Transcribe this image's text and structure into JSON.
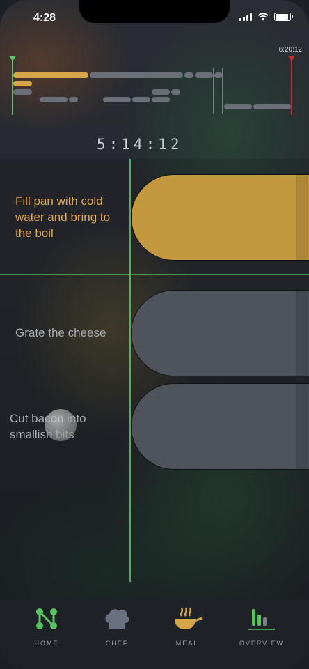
{
  "status_bar": {
    "time": "4:28"
  },
  "timeline": {
    "end_time": "6:20:12",
    "elapsed": "5:14:12"
  },
  "steps": [
    {
      "text": "Fill pan with cold water and bring to the boil",
      "state": "active"
    },
    {
      "text": "Grate the cheese",
      "state": "upcoming"
    },
    {
      "text": "Cut bacon into smallish bits",
      "state": "upcoming"
    }
  ],
  "tabs": [
    {
      "label": "HOME",
      "icon": "home-network-icon"
    },
    {
      "label": "CHEF",
      "icon": "chef-hat-icon"
    },
    {
      "label": "MEAL",
      "icon": "cooking-pan-icon"
    },
    {
      "label": "OVERVIEW",
      "icon": "bar-chart-icon"
    }
  ],
  "colors": {
    "accent_gold": "#d7a648",
    "now_line": "#57c463",
    "end_marker": "#c92c2c",
    "pill_gray": "#4e535c"
  }
}
